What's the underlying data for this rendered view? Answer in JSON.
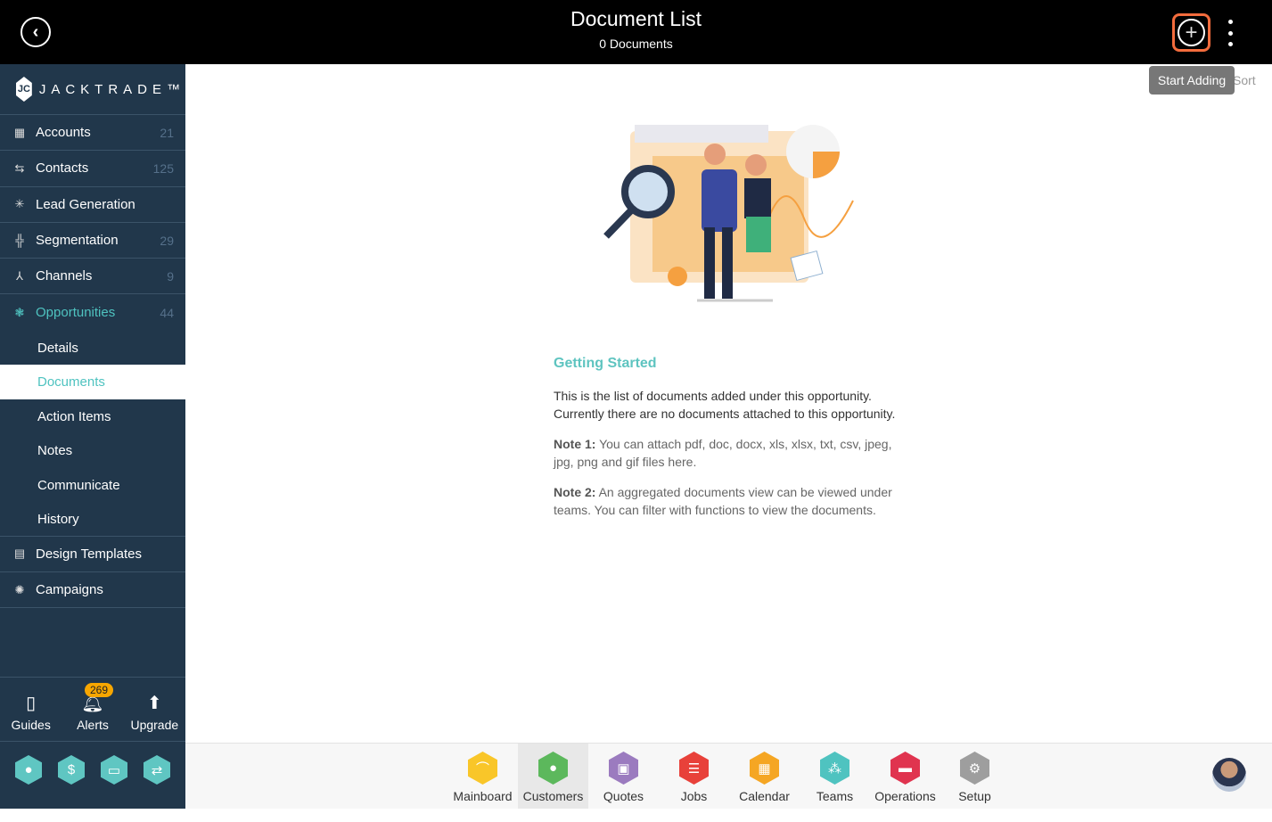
{
  "header": {
    "title": "Document List",
    "subtitle": "0 Documents",
    "add_tooltip": "Start Adding",
    "sort_label": "Sort"
  },
  "sidebar": {
    "brand": "JACKTRADE™",
    "items": [
      {
        "label": "Accounts",
        "count": "21",
        "icon": "building-icon"
      },
      {
        "label": "Contacts",
        "count": "125",
        "icon": "contacts-icon"
      },
      {
        "label": "Lead Generation",
        "count": "",
        "icon": "network-icon"
      },
      {
        "label": "Segmentation",
        "count": "29",
        "icon": "segmentation-icon"
      },
      {
        "label": "Channels",
        "count": "9",
        "icon": "channels-icon"
      },
      {
        "label": "Opportunities",
        "count": "44",
        "icon": "opportunities-icon"
      }
    ],
    "sub_items": [
      "Details",
      "Documents",
      "Action Items",
      "Notes",
      "Communicate",
      "History"
    ],
    "selected_sub": "Documents",
    "more_items": [
      {
        "label": "Design Templates",
        "icon": "templates-icon"
      },
      {
        "label": "Campaigns",
        "icon": "campaigns-icon"
      }
    ],
    "tools": [
      {
        "label": "Guides"
      },
      {
        "label": "Alerts",
        "badge": "269"
      },
      {
        "label": "Upgrade"
      }
    ]
  },
  "content": {
    "heading": "Getting Started",
    "intro": "This is the list of documents added under this opportunity. Currently there are no documents attached to this opportunity.",
    "note1_label": "Note 1:",
    "note1": " You can attach pdf, doc, docx, xls, xlsx, txt, csv, jpeg, jpg, png and gif files here.",
    "note2_label": "Note 2:",
    "note2": " An aggregated documents view can be viewed under teams. You can filter with functions to view the documents."
  },
  "bottom_nav": [
    {
      "label": "Mainboard",
      "color": "#f9c629"
    },
    {
      "label": "Customers",
      "color": "#5cb85c",
      "selected": true
    },
    {
      "label": "Quotes",
      "color": "#9b7bbf"
    },
    {
      "label": "Jobs",
      "color": "#e8413a"
    },
    {
      "label": "Calendar",
      "color": "#f5a623"
    },
    {
      "label": "Teams",
      "color": "#4fc3c0"
    },
    {
      "label": "Operations",
      "color": "#e0344f"
    },
    {
      "label": "Setup",
      "color": "#9e9e9e"
    }
  ],
  "colors": {
    "sidebar": "#21374b",
    "accent": "#4fc3c0",
    "add_border": "#f36c3d",
    "badge": "#f7a600"
  }
}
